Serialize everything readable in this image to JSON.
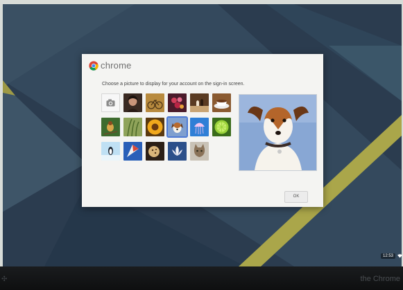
{
  "dialog": {
    "brand_name": "chrome",
    "prompt": "Choose a picture to display for your account on the sign-in screen.",
    "ok_label": "OK"
  },
  "pictures": [
    {
      "icon": "camera-icon",
      "row": 1
    },
    {
      "icon": "woman-photo",
      "row": 1
    },
    {
      "icon": "bicycle-photo",
      "row": 1
    },
    {
      "icon": "flowers-photo",
      "row": 1
    },
    {
      "icon": "chess-photo",
      "row": 1
    },
    {
      "icon": "coffee-photo",
      "row": 1
    },
    {
      "icon": "bird-photo",
      "row": 2
    },
    {
      "icon": "grass-photo",
      "row": 2
    },
    {
      "icon": "sunflower-photo",
      "row": 2
    },
    {
      "icon": "dog-photo",
      "row": 2,
      "selected": true
    },
    {
      "icon": "jellyfish-photo",
      "row": 2
    },
    {
      "icon": "lime-photo",
      "row": 2
    },
    {
      "icon": "penguin-photo",
      "row": 3
    },
    {
      "icon": "kite-photo",
      "row": 3
    },
    {
      "icon": "cookie-photo",
      "row": 3
    },
    {
      "icon": "lotus-photo",
      "row": 3
    },
    {
      "icon": "cat-photo",
      "row": 3
    }
  ],
  "status_tray": {
    "time": "12:53",
    "wifi_icon": "wifi-icon"
  },
  "bezel": {
    "brand": "the Chrome"
  },
  "colors": {
    "wallpaper": "#2f4256",
    "accent_selection": "#4d79d4",
    "wallpaper_stripe": "#a8a64a"
  }
}
